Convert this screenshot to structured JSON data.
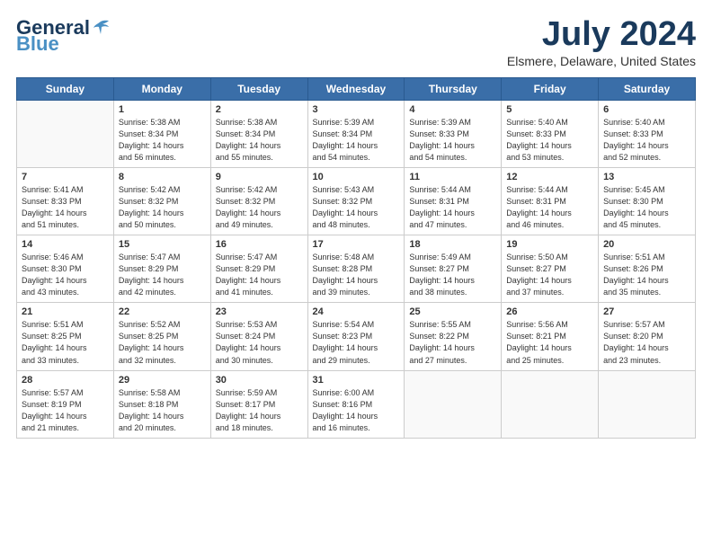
{
  "header": {
    "logo_general": "General",
    "logo_blue": "Blue",
    "logo_tagline": "",
    "title": "July 2024",
    "subtitle": "Elsmere, Delaware, United States"
  },
  "calendar": {
    "days_of_week": [
      "Sunday",
      "Monday",
      "Tuesday",
      "Wednesday",
      "Thursday",
      "Friday",
      "Saturday"
    ],
    "weeks": [
      [
        {
          "day": "",
          "info": ""
        },
        {
          "day": "1",
          "info": "Sunrise: 5:38 AM\nSunset: 8:34 PM\nDaylight: 14 hours\nand 56 minutes."
        },
        {
          "day": "2",
          "info": "Sunrise: 5:38 AM\nSunset: 8:34 PM\nDaylight: 14 hours\nand 55 minutes."
        },
        {
          "day": "3",
          "info": "Sunrise: 5:39 AM\nSunset: 8:34 PM\nDaylight: 14 hours\nand 54 minutes."
        },
        {
          "day": "4",
          "info": "Sunrise: 5:39 AM\nSunset: 8:33 PM\nDaylight: 14 hours\nand 54 minutes."
        },
        {
          "day": "5",
          "info": "Sunrise: 5:40 AM\nSunset: 8:33 PM\nDaylight: 14 hours\nand 53 minutes."
        },
        {
          "day": "6",
          "info": "Sunrise: 5:40 AM\nSunset: 8:33 PM\nDaylight: 14 hours\nand 52 minutes."
        }
      ],
      [
        {
          "day": "7",
          "info": "Sunrise: 5:41 AM\nSunset: 8:33 PM\nDaylight: 14 hours\nand 51 minutes."
        },
        {
          "day": "8",
          "info": "Sunrise: 5:42 AM\nSunset: 8:32 PM\nDaylight: 14 hours\nand 50 minutes."
        },
        {
          "day": "9",
          "info": "Sunrise: 5:42 AM\nSunset: 8:32 PM\nDaylight: 14 hours\nand 49 minutes."
        },
        {
          "day": "10",
          "info": "Sunrise: 5:43 AM\nSunset: 8:32 PM\nDaylight: 14 hours\nand 48 minutes."
        },
        {
          "day": "11",
          "info": "Sunrise: 5:44 AM\nSunset: 8:31 PM\nDaylight: 14 hours\nand 47 minutes."
        },
        {
          "day": "12",
          "info": "Sunrise: 5:44 AM\nSunset: 8:31 PM\nDaylight: 14 hours\nand 46 minutes."
        },
        {
          "day": "13",
          "info": "Sunrise: 5:45 AM\nSunset: 8:30 PM\nDaylight: 14 hours\nand 45 minutes."
        }
      ],
      [
        {
          "day": "14",
          "info": "Sunrise: 5:46 AM\nSunset: 8:30 PM\nDaylight: 14 hours\nand 43 minutes."
        },
        {
          "day": "15",
          "info": "Sunrise: 5:47 AM\nSunset: 8:29 PM\nDaylight: 14 hours\nand 42 minutes."
        },
        {
          "day": "16",
          "info": "Sunrise: 5:47 AM\nSunset: 8:29 PM\nDaylight: 14 hours\nand 41 minutes."
        },
        {
          "day": "17",
          "info": "Sunrise: 5:48 AM\nSunset: 8:28 PM\nDaylight: 14 hours\nand 39 minutes."
        },
        {
          "day": "18",
          "info": "Sunrise: 5:49 AM\nSunset: 8:27 PM\nDaylight: 14 hours\nand 38 minutes."
        },
        {
          "day": "19",
          "info": "Sunrise: 5:50 AM\nSunset: 8:27 PM\nDaylight: 14 hours\nand 37 minutes."
        },
        {
          "day": "20",
          "info": "Sunrise: 5:51 AM\nSunset: 8:26 PM\nDaylight: 14 hours\nand 35 minutes."
        }
      ],
      [
        {
          "day": "21",
          "info": "Sunrise: 5:51 AM\nSunset: 8:25 PM\nDaylight: 14 hours\nand 33 minutes."
        },
        {
          "day": "22",
          "info": "Sunrise: 5:52 AM\nSunset: 8:25 PM\nDaylight: 14 hours\nand 32 minutes."
        },
        {
          "day": "23",
          "info": "Sunrise: 5:53 AM\nSunset: 8:24 PM\nDaylight: 14 hours\nand 30 minutes."
        },
        {
          "day": "24",
          "info": "Sunrise: 5:54 AM\nSunset: 8:23 PM\nDaylight: 14 hours\nand 29 minutes."
        },
        {
          "day": "25",
          "info": "Sunrise: 5:55 AM\nSunset: 8:22 PM\nDaylight: 14 hours\nand 27 minutes."
        },
        {
          "day": "26",
          "info": "Sunrise: 5:56 AM\nSunset: 8:21 PM\nDaylight: 14 hours\nand 25 minutes."
        },
        {
          "day": "27",
          "info": "Sunrise: 5:57 AM\nSunset: 8:20 PM\nDaylight: 14 hours\nand 23 minutes."
        }
      ],
      [
        {
          "day": "28",
          "info": "Sunrise: 5:57 AM\nSunset: 8:19 PM\nDaylight: 14 hours\nand 21 minutes."
        },
        {
          "day": "29",
          "info": "Sunrise: 5:58 AM\nSunset: 8:18 PM\nDaylight: 14 hours\nand 20 minutes."
        },
        {
          "day": "30",
          "info": "Sunrise: 5:59 AM\nSunset: 8:17 PM\nDaylight: 14 hours\nand 18 minutes."
        },
        {
          "day": "31",
          "info": "Sunrise: 6:00 AM\nSunset: 8:16 PM\nDaylight: 14 hours\nand 16 minutes."
        },
        {
          "day": "",
          "info": ""
        },
        {
          "day": "",
          "info": ""
        },
        {
          "day": "",
          "info": ""
        }
      ]
    ]
  }
}
